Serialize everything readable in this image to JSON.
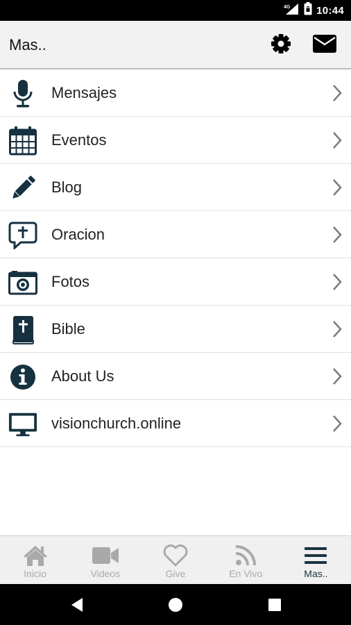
{
  "status_bar": {
    "network": "4G",
    "time": "10:44"
  },
  "app_bar": {
    "title": "Mas..",
    "settings_icon": "gear-icon",
    "mail_icon": "envelope-icon"
  },
  "menu": [
    {
      "label": "Mensajes",
      "icon": "microphone-icon"
    },
    {
      "label": "Eventos",
      "icon": "calendar-icon"
    },
    {
      "label": "Blog",
      "icon": "pencil-icon"
    },
    {
      "label": "Oracion",
      "icon": "prayer-bubble-icon"
    },
    {
      "label": "Fotos",
      "icon": "camera-icon"
    },
    {
      "label": "Bible",
      "icon": "bible-icon"
    },
    {
      "label": "About Us",
      "icon": "info-icon"
    },
    {
      "label": "visionchurch.online",
      "icon": "monitor-icon"
    }
  ],
  "tabs": [
    {
      "label": "Inicio",
      "icon": "home-icon",
      "active": false
    },
    {
      "label": "Videos",
      "icon": "video-camera-icon",
      "active": false
    },
    {
      "label": "Give",
      "icon": "heart-icon",
      "active": false
    },
    {
      "label": "En Vivo",
      "icon": "rss-icon",
      "active": false
    },
    {
      "label": "Mas..",
      "icon": "menu-icon",
      "active": true
    }
  ],
  "colors": {
    "icon": "#16313f",
    "tab_inactive": "#a9a9a9",
    "tab_active": "#1a3441",
    "chevron": "#7a7a7a"
  }
}
